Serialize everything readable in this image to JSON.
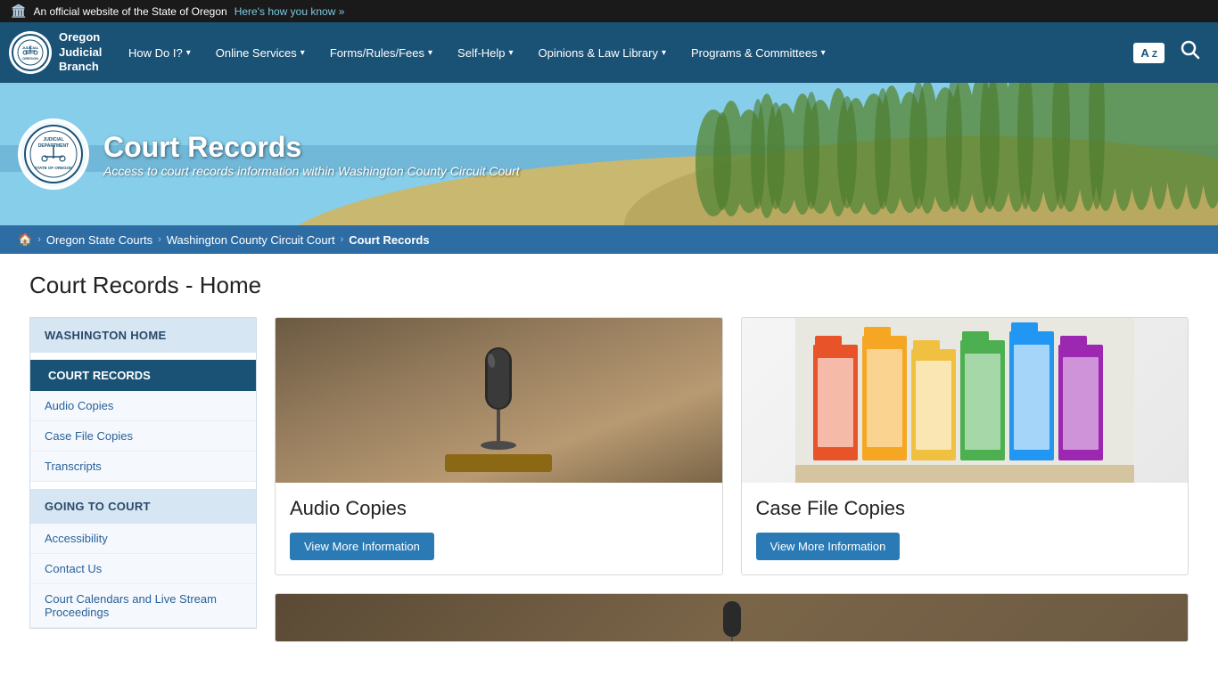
{
  "topBar": {
    "text": "An official website of the State of Oregon",
    "linkText": "Here's how you know »"
  },
  "nav": {
    "logoLine1": "Oregon",
    "logoLine2": "Judicial",
    "logoLine3": "Branch",
    "items": [
      {
        "label": "How Do I?",
        "hasDropdown": true
      },
      {
        "label": "Online Services",
        "hasDropdown": true
      },
      {
        "label": "Forms/Rules/Fees",
        "hasDropdown": true
      },
      {
        "label": "Self-Help",
        "hasDropdown": true
      },
      {
        "label": "Opinions & Law Library",
        "hasDropdown": true
      },
      {
        "label": "Programs & Committees",
        "hasDropdown": true
      }
    ],
    "translateLabel": "A Z",
    "searchLabel": "🔍"
  },
  "hero": {
    "title": "Court Records",
    "subtitle": "Access to court records information within Washington County Circuit Court",
    "sealText": "JUDICIAL DEPARTMENT STATE OF OREGON"
  },
  "breadcrumb": {
    "home": "🏠",
    "items": [
      {
        "label": "Oregon State Courts",
        "href": "#"
      },
      {
        "label": "Washington County Circuit Court",
        "href": "#"
      },
      {
        "label": "Court Records",
        "current": true
      }
    ]
  },
  "pageTitle": "Court Records - Home",
  "sidebar": {
    "washingtonHomeLabel": "Washington Home",
    "courtRecordsLabel": "Court Records",
    "courtRecordsItems": [
      {
        "label": "Audio Copies"
      },
      {
        "label": "Case File Copies"
      },
      {
        "label": "Transcripts"
      }
    ],
    "goingToCourtLabel": "Going to Court",
    "goingToCourtItems": [
      {
        "label": "Accessibility"
      },
      {
        "label": "Contact Us"
      },
      {
        "label": "Court Calendars and Live Stream Proceedings"
      }
    ]
  },
  "cards": [
    {
      "title": "Audio Copies",
      "btnLabel": "View More Information",
      "imageType": "mic"
    },
    {
      "title": "Case File Copies",
      "btnLabel": "View More Information",
      "imageType": "files"
    }
  ],
  "colors": {
    "navBg": "#1a5276",
    "activeBlue": "#1a5276",
    "linkBlue": "#2a7ab5",
    "sidebarHeaderBg": "#d6e6f2",
    "sidebarActiveBg": "#1a5276"
  }
}
